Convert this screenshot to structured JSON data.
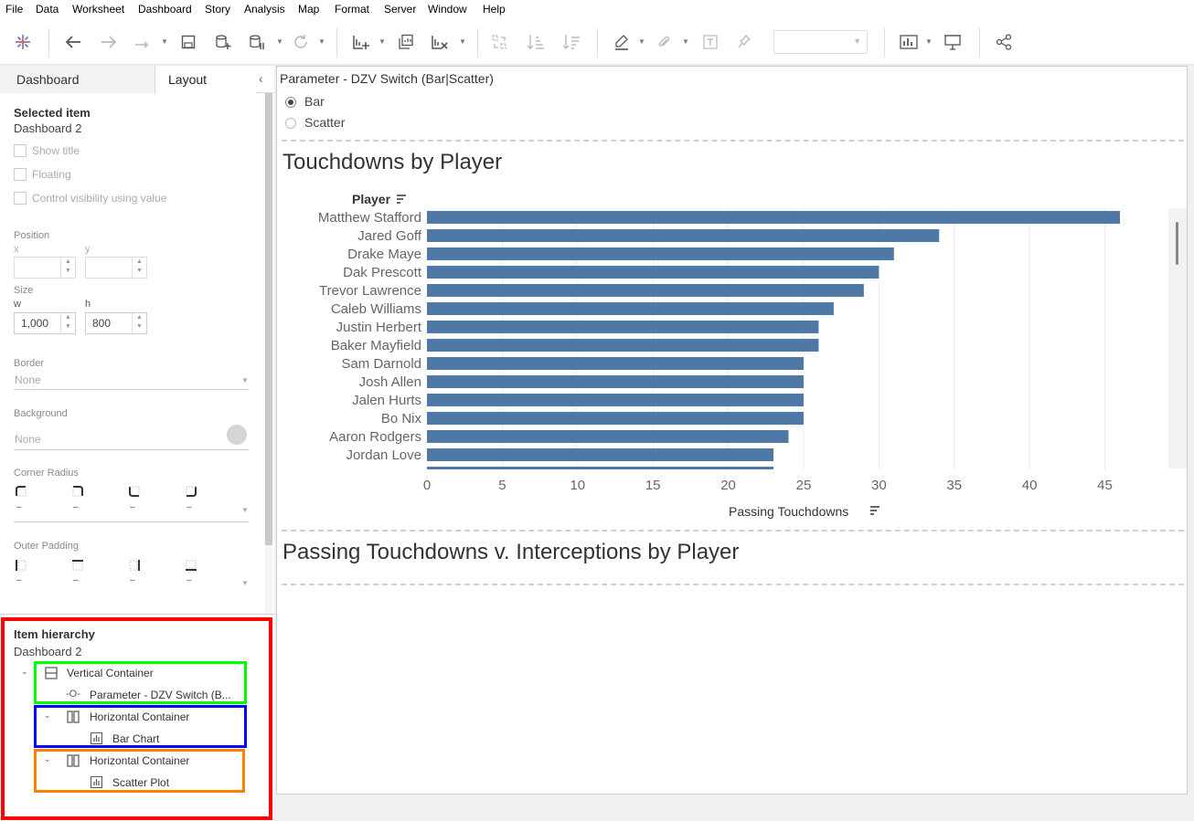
{
  "menu": [
    "File",
    "Data",
    "Worksheet",
    "Dashboard",
    "Story",
    "Analysis",
    "Map",
    "Format",
    "Server",
    "Window",
    "Help"
  ],
  "toolbar": {
    "icons": [
      "tableau-logo-icon",
      "back-icon",
      "forward-icon",
      "redo-icon",
      "save-icon",
      "new-data-source-icon",
      "pause-updates-icon",
      "refresh-icon",
      "new-worksheet-icon",
      "duplicate-sheet-icon",
      "clear-sheet-icon",
      "swap-axes-icon",
      "sort-ascending-icon",
      "sort-descending-icon",
      "highlight-icon",
      "label-icon",
      "text-icon",
      "pin-icon",
      "show-me-icon",
      "presentation-icon",
      "share-icon"
    ]
  },
  "left_panel": {
    "tabs": {
      "dashboard": "Dashboard",
      "layout": "Layout"
    },
    "selected_item": {
      "heading": "Selected item",
      "value": "Dashboard 2"
    },
    "checkboxes": [
      "Show title",
      "Floating",
      "Control visibility using value"
    ],
    "position": {
      "label": "Position",
      "x_label": "x",
      "y_label": "y",
      "x": "",
      "y": ""
    },
    "size": {
      "label": "Size",
      "w_label": "w",
      "h_label": "h",
      "w": "1,000",
      "h": "800"
    },
    "border": {
      "label": "Border",
      "value": "None"
    },
    "background": {
      "label": "Background",
      "value": "None"
    },
    "corner_radius": {
      "label": "Corner Radius",
      "values": [
        "–",
        "–",
        "–",
        "–"
      ]
    },
    "outer_padding": {
      "label": "Outer Padding",
      "values": [
        "–",
        "–",
        "–",
        "–"
      ]
    },
    "hierarchy": {
      "heading": "Item hierarchy",
      "root": "Dashboard 2",
      "items": [
        {
          "label": "Vertical Container"
        },
        {
          "label": "Parameter - DZV Switch (B..."
        },
        {
          "label": "Horizontal Container"
        },
        {
          "label": "Bar Chart"
        },
        {
          "label": "Horizontal Container"
        },
        {
          "label": "Scatter Plot"
        }
      ],
      "colors": {
        "outer": "#ff0000",
        "vertical": "#00ff00",
        "horizontal1": "#0000ff",
        "horizontal2": "#ff8000"
      }
    }
  },
  "dashboard": {
    "parameter": {
      "title": "Parameter - DZV Switch (Bar|Scatter)",
      "options": [
        "Bar",
        "Scatter"
      ],
      "selected": "Bar"
    },
    "bar_sheet_title": "Touchdowns by Player",
    "scatter_sheet_title": "Passing Touchdowns v. Interceptions by Player"
  },
  "chart_data": {
    "type": "bar",
    "orientation": "horizontal",
    "title": "Touchdowns by Player",
    "row_header": "Player",
    "xlabel": "Passing Touchdowns",
    "categories": [
      "Matthew Stafford",
      "Jared Goff",
      "Drake Maye",
      "Dak Prescott",
      "Trevor Lawrence",
      "Caleb Williams",
      "Justin Herbert",
      "Baker Mayfield",
      "Sam Darnold",
      "Josh Allen",
      "Jalen Hurts",
      "Bo Nix",
      "Aaron Rodgers",
      "Jordan Love"
    ],
    "values": [
      46,
      34,
      31,
      30,
      29,
      27,
      26,
      26,
      25,
      25,
      25,
      25,
      24,
      23
    ],
    "partial_last_value": 23,
    "xlim": [
      0,
      50
    ],
    "xticks": [
      0,
      5,
      10,
      15,
      20,
      25,
      30,
      35,
      40,
      45
    ],
    "bar_color": "#4e79a7",
    "gridlines": true
  }
}
